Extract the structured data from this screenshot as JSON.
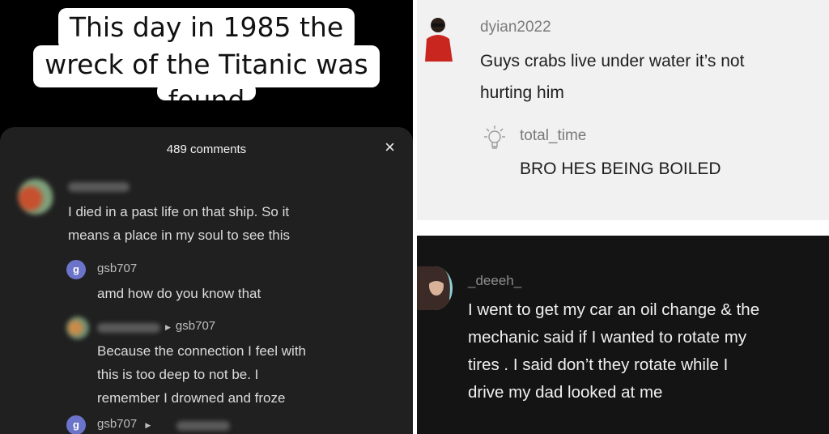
{
  "left": {
    "caption_line1": "This day in 1985 the",
    "caption_line2": "wreck of the Titanic was",
    "caption_line3": "found",
    "comment_count": "489 comments",
    "close_icon": "×",
    "comments": [
      {
        "text_line1": "I died in a past life on that ship. So it",
        "text_line2": "means a place in my soul to see this"
      },
      {
        "avatar_letter": "g",
        "username": "gsb707",
        "text": "amd how do you know that"
      },
      {
        "reply_to": "gsb707",
        "text_line1": "Because the connection I feel with",
        "text_line2": "this is too deep to not be. I",
        "text_line3": "remember I drowned and froze"
      },
      {
        "avatar_letter": "g",
        "username": "gsb707"
      }
    ]
  },
  "top_right": {
    "comment": {
      "username": "dyian2022",
      "text_line1": "Guys crabs live under water it’s not",
      "text_line2": "hurting him"
    },
    "reply": {
      "username": "total_time",
      "text": "BRO HES BEING BOILED",
      "icon": "lightbulb-icon"
    }
  },
  "bottom_right": {
    "username": "_deeeh_",
    "text_line1": "I went to get my car an oil change & the",
    "text_line2": "mechanic said if I wanted to rotate my",
    "text_line3": "tires . I said don’t they rotate while I",
    "text_line4": "drive my dad looked at me"
  }
}
